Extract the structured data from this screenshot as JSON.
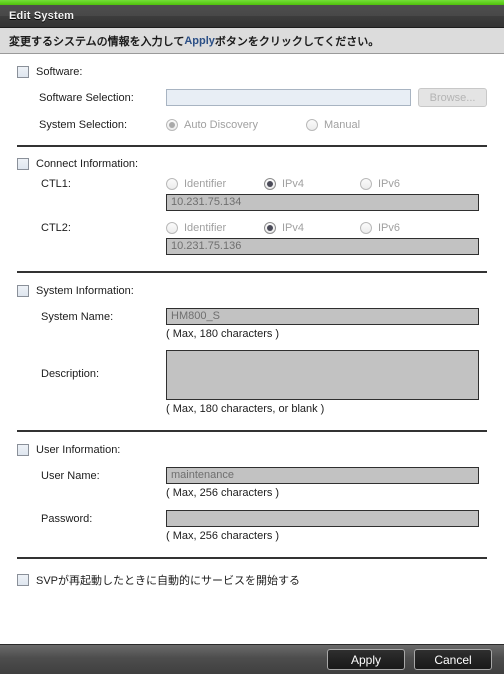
{
  "window": {
    "title": "Edit System",
    "accent_color": "#5fd41c"
  },
  "instruction": {
    "prefix": "変更するシステムの情報を入力して",
    "keyword": "Apply",
    "suffix": "ボタンをクリックしてください。"
  },
  "sections": {
    "software": {
      "checkbox_label": "Software:",
      "checked": false,
      "software_selection_label": "Software Selection:",
      "software_selection_value": "",
      "browse_label": "Browse...",
      "system_selection_label": "System Selection:",
      "system_selection_options": [
        {
          "label": "Auto Discovery",
          "selected": true
        },
        {
          "label": "Manual",
          "selected": false
        }
      ]
    },
    "connect": {
      "checkbox_label": "Connect Information:",
      "checked": false,
      "ctl1": {
        "label": "CTL1:",
        "options": [
          {
            "label": "Identifier",
            "selected": false
          },
          {
            "label": "IPv4",
            "selected": true
          },
          {
            "label": "IPv6",
            "selected": false
          }
        ],
        "address": "10.231.75.134"
      },
      "ctl2": {
        "label": "CTL2:",
        "options": [
          {
            "label": "Identifier",
            "selected": false
          },
          {
            "label": "IPv4",
            "selected": true
          },
          {
            "label": "IPv6",
            "selected": false
          }
        ],
        "address": "10.231.75.136"
      }
    },
    "system_information": {
      "checkbox_label": "System Information:",
      "checked": false,
      "system_name_label": "System Name:",
      "system_name_value": "HM800_S",
      "system_name_hint": "( Max, 180 characters )",
      "description_label": "Description:",
      "description_value": "",
      "description_hint": "( Max, 180 characters, or blank )"
    },
    "user_information": {
      "checkbox_label": "User Information:",
      "checked": false,
      "user_name_label": "User Name:",
      "user_name_value": "maintenance",
      "user_name_hint": "( Max, 256 characters )",
      "password_label": "Password:",
      "password_value": "",
      "password_hint": "( Max, 256 characters )"
    },
    "auto_start": {
      "checkbox_label": "SVPが再起動したときに自動的にサービスを開始する",
      "checked": false
    }
  },
  "footer": {
    "apply_label": "Apply",
    "cancel_label": "Cancel"
  }
}
